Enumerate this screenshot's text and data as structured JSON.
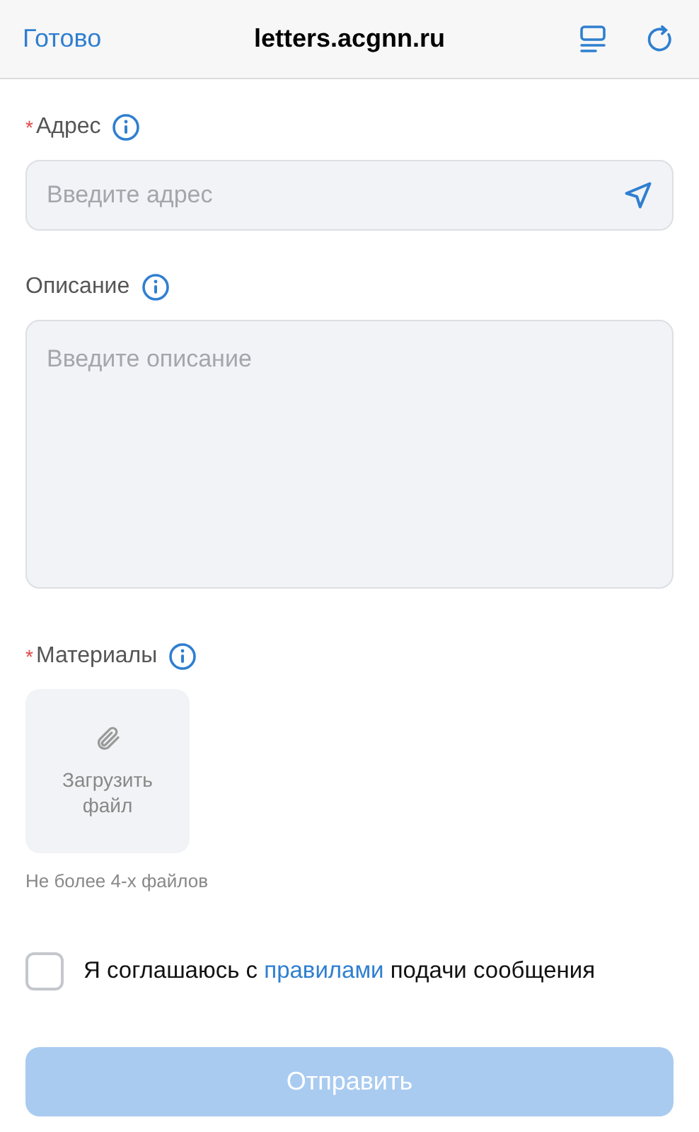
{
  "header": {
    "done": "Готово",
    "title": "letters.acgnn.ru"
  },
  "fields": [
    {
      "kind": "input",
      "mark": "*",
      "label": "Адрес",
      "placeholder": "Введите адрес"
    },
    {
      "kind": "textarea",
      "label": "Описание",
      "placeholder": "Введите описание"
    },
    {
      "kind": "upload",
      "mark": "*",
      "label": "Материалы",
      "button": "Загрузить файл",
      "hint": "Не более 4-х файлов"
    }
  ],
  "agreement": {
    "checked": false,
    "before": "Я соглашаюсь с",
    "link": "правилами",
    "after": "подачи сообщения"
  },
  "submit": {
    "label": "Отправить",
    "disabled": true
  }
}
